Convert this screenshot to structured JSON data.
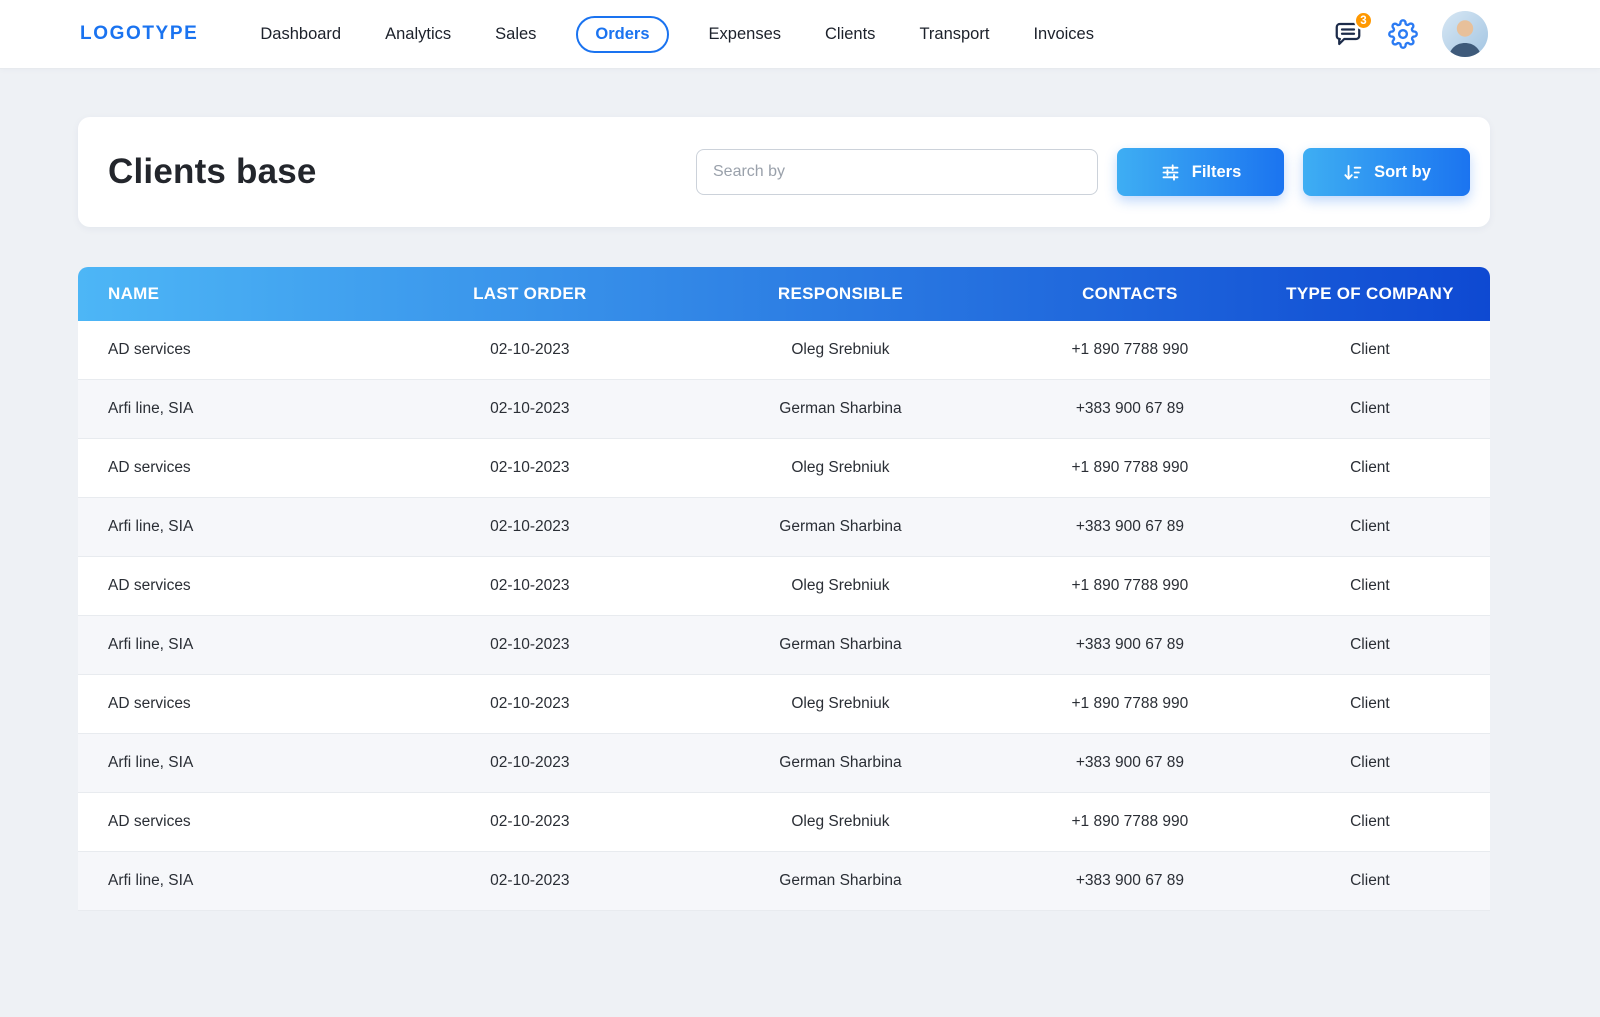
{
  "brand": {
    "logo": "LOGOTYPE"
  },
  "nav": {
    "items": [
      {
        "label": "Dashboard",
        "active": false
      },
      {
        "label": "Analytics",
        "active": false
      },
      {
        "label": "Sales",
        "active": false
      },
      {
        "label": "Orders",
        "active": true
      },
      {
        "label": "Expenses",
        "active": false
      },
      {
        "label": "Clients",
        "active": false
      },
      {
        "label": "Transport",
        "active": false
      },
      {
        "label": "Invoices",
        "active": false
      }
    ]
  },
  "topbar": {
    "notification_badge": "3"
  },
  "page": {
    "title": "Clients base"
  },
  "toolbar": {
    "search_placeholder": "Search by",
    "filters_label": "Filters",
    "sort_label": "Sort by"
  },
  "table": {
    "columns": [
      "NAME",
      "LAST ORDER",
      "RESPONSIBLE",
      "CONTACTS",
      "TYPE OF COMPANY"
    ],
    "rows": [
      [
        "AD services",
        "02-10-2023",
        "Oleg Srebniuk",
        "+1 890 7788 990",
        "Client"
      ],
      [
        "Arfi line, SIA",
        "02-10-2023",
        "German Sharbina",
        "+383 900 67 89",
        "Client"
      ],
      [
        "AD services",
        "02-10-2023",
        "Oleg Srebniuk",
        "+1 890 7788 990",
        "Client"
      ],
      [
        "Arfi line, SIA",
        "02-10-2023",
        "German Sharbina",
        "+383 900 67 89",
        "Client"
      ],
      [
        "AD services",
        "02-10-2023",
        "Oleg Srebniuk",
        "+1 890 7788 990",
        "Client"
      ],
      [
        "Arfi line, SIA",
        "02-10-2023",
        "German Sharbina",
        "+383 900 67 89",
        "Client"
      ],
      [
        "AD services",
        "02-10-2023",
        "Oleg Srebniuk",
        "+1 890 7788 990",
        "Client"
      ],
      [
        "Arfi line, SIA",
        "02-10-2023",
        "German Sharbina",
        "+383 900 67 89",
        "Client"
      ],
      [
        "AD services",
        "02-10-2023",
        "Oleg Srebniuk",
        "+1 890 7788 990",
        "Client"
      ],
      [
        "Arfi line, SIA",
        "02-10-2023",
        "German Sharbina",
        "+383 900 67 89",
        "Client"
      ]
    ]
  },
  "colors": {
    "accent": "#1a73f0",
    "badge": "#ff9800",
    "btn_grad_start": "#3eaef3",
    "btn_grad_end": "#1b74f0",
    "thead_grad_start": "#4db6f6",
    "thead_grad_end": "#0e49d2"
  }
}
